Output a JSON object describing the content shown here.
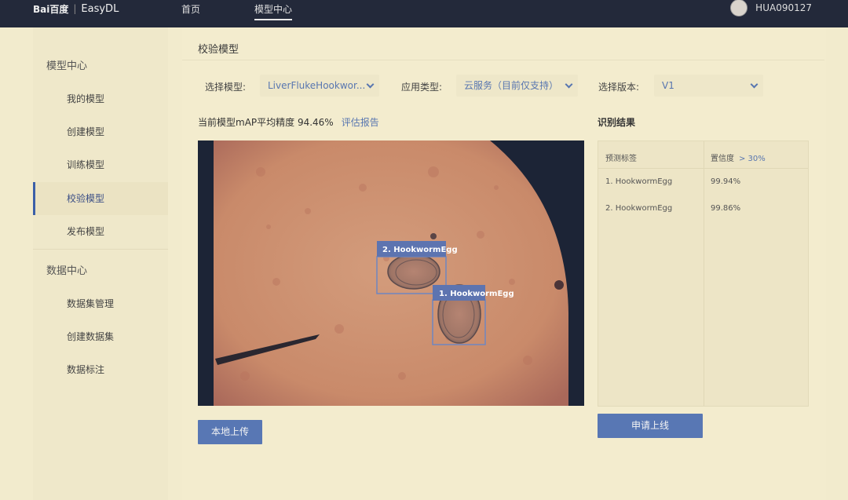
{
  "brand": {
    "logo": "Bai百度",
    "product": "EasyDL"
  },
  "nav": {
    "home": "首页",
    "model_center": "模型中心"
  },
  "user": {
    "name": "HUA090127"
  },
  "sidebar": {
    "group1": "模型中心",
    "items1": [
      "我的模型",
      "创建模型",
      "训练模型",
      "校验模型",
      "发布模型"
    ],
    "group2": "数据中心",
    "items2": [
      "数据集管理",
      "创建数据集",
      "数据标注"
    ]
  },
  "page": {
    "title": "校验模型",
    "filters": {
      "model_label": "选择模型:",
      "model_value": "LiverFlukeHookwor...",
      "app_type_label": "应用类型:",
      "app_type_value": "云服务（目前仅支持）",
      "version_label": "选择版本:",
      "version_value": "V1"
    },
    "map_text": "当前模型mAP平均精度 94.46%",
    "eval_report_link": "评估报告",
    "upload_button": "本地上传"
  },
  "image": {
    "detections": [
      {
        "label": "2. HookwormEgg"
      },
      {
        "label": "1. HookwormEgg"
      }
    ]
  },
  "results": {
    "title": "识别结果",
    "col_label": "预测标签",
    "col_confidence": "置信度",
    "threshold": "> 30%",
    "rows": [
      {
        "label": "1. HookwormEgg",
        "confidence": "99.94%"
      },
      {
        "label": "2. HookwormEgg",
        "confidence": "99.86%"
      }
    ],
    "online_button": "申请上线"
  },
  "colors": {
    "accent": "#5877b4",
    "nav_bg": "#23293a",
    "box": "#6f86c0"
  }
}
